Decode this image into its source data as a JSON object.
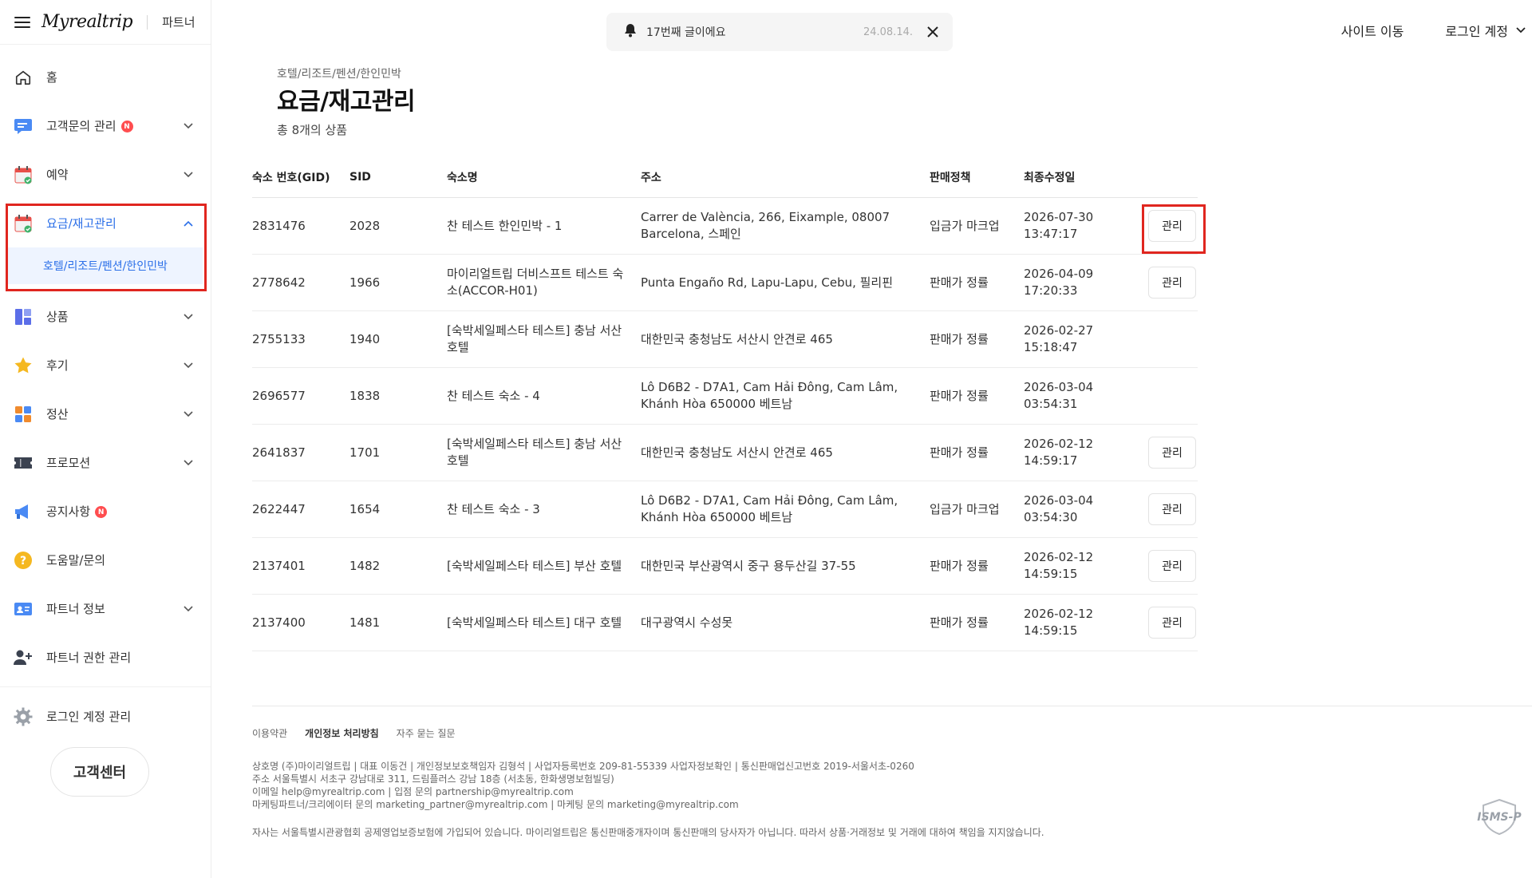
{
  "brand": {
    "logo": "Myrealtrip",
    "partner": "파트너"
  },
  "sidebar": {
    "items": [
      {
        "label": "홈",
        "icon": "home-icon",
        "badge": "",
        "chevron": ""
      },
      {
        "label": "고객문의 관리",
        "icon": "chat-icon",
        "badge": "N",
        "chevron": "down"
      },
      {
        "label": "예약",
        "icon": "calendar-check-icon",
        "badge": "",
        "chevron": "down"
      },
      {
        "label": "요금/재고관리",
        "icon": "calendar-check-icon",
        "badge": "",
        "chevron": "up"
      },
      {
        "label": "상품",
        "icon": "dashboard-icon",
        "badge": "",
        "chevron": "down"
      },
      {
        "label": "후기",
        "icon": "star-icon",
        "badge": "",
        "chevron": "down"
      },
      {
        "label": "정산",
        "icon": "grid-icon",
        "badge": "",
        "chevron": "down"
      },
      {
        "label": "프로모션",
        "icon": "ticket-icon",
        "badge": "",
        "chevron": "down"
      },
      {
        "label": "공지사항",
        "icon": "megaphone-icon",
        "badge": "N",
        "chevron": ""
      },
      {
        "label": "도움말/문의",
        "icon": "question-icon",
        "badge": "",
        "chevron": ""
      },
      {
        "label": "파트너 정보",
        "icon": "id-card-icon",
        "badge": "",
        "chevron": "down"
      },
      {
        "label": "파트너 권한 관리",
        "icon": "user-add-icon",
        "badge": "",
        "chevron": ""
      },
      {
        "label": "로그인 계정 관리",
        "icon": "gear-icon",
        "badge": "",
        "chevron": ""
      }
    ],
    "sub_item": "호텔/리조트/펜션/한인민박",
    "cs_button": "고객센터"
  },
  "notice": {
    "text": "17번째 글이에요",
    "date": "24.08.14."
  },
  "topbar": {
    "site_move": "사이트 이동",
    "account": "로그인 계정"
  },
  "main": {
    "breadcrumb": "호텔/리조트/펜션/한인민박",
    "title": "요금/재고관리",
    "count": "총 8개의 상품"
  },
  "table": {
    "headers": [
      "숙소 번호(GID)",
      "SID",
      "숙소명",
      "주소",
      "판매정책",
      "최종수정일"
    ],
    "rows": [
      {
        "gid": "2831476",
        "sid": "2028",
        "name": "찬 테스트 한인민박 - 1",
        "address": "Carrer de València, 266, Eixample, 08007 Barcelona, 스페인",
        "policy": "입금가 마크업",
        "date": "2026-07-30",
        "time": "13:47:17",
        "manage": "관리"
      },
      {
        "gid": "2778642",
        "sid": "1966",
        "name": "마이리얼트립 더비스프트 테스트 숙소(ACCOR-H01)",
        "address": "Punta Engaño Rd, Lapu-Lapu, Cebu, 필리핀",
        "policy": "판매가 정률",
        "date": "2026-04-09",
        "time": "17:20:33",
        "manage": "관리"
      },
      {
        "gid": "2755133",
        "sid": "1940",
        "name": "[숙박세일페스타 테스트] 충남 서산 호텔",
        "address": "대한민국 충청남도 서산시 안견로 465",
        "policy": "판매가 정률",
        "date": "2026-02-27",
        "time": "15:18:47",
        "manage": ""
      },
      {
        "gid": "2696577",
        "sid": "1838",
        "name": "찬 테스트 숙소 - 4",
        "address": "Lô D6B2 - D7A1, Cam Hải Đông, Cam Lâm, Khánh Hòa 650000 베트남",
        "policy": "판매가 정률",
        "date": "2026-03-04",
        "time": "03:54:31",
        "manage": ""
      },
      {
        "gid": "2641837",
        "sid": "1701",
        "name": "[숙박세일페스타 테스트] 충남 서산 호텔",
        "address": "대한민국 충청남도 서산시 안견로 465",
        "policy": "판매가 정률",
        "date": "2026-02-12",
        "time": "14:59:17",
        "manage": "관리"
      },
      {
        "gid": "2622447",
        "sid": "1654",
        "name": "찬 테스트 숙소 - 3",
        "address": "Lô D6B2 - D7A1, Cam Hải Đông, Cam Lâm, Khánh Hòa 650000 베트남",
        "policy": "입금가 마크업",
        "date": "2026-03-04",
        "time": "03:54:30",
        "manage": "관리"
      },
      {
        "gid": "2137401",
        "sid": "1482",
        "name": "[숙박세일페스타 테스트] 부산 호텔",
        "address": "대한민국 부산광역시 중구 용두산길 37-55",
        "policy": "판매가 정률",
        "date": "2026-02-12",
        "time": "14:59:15",
        "manage": "관리"
      },
      {
        "gid": "2137400",
        "sid": "1481",
        "name": "[숙박세일페스타 테스트] 대구 호텔",
        "address": "대구광역시 수성못",
        "policy": "판매가 정률",
        "date": "2026-02-12",
        "time": "14:59:15",
        "manage": "관리"
      }
    ]
  },
  "footer": {
    "links": [
      "이용약관",
      "개인정보 처리방침",
      "자주 묻는 질문"
    ],
    "info": [
      "상호명 (주)마이리얼트립 | 대표 이동건 | 개인정보보호책임자 김형석 | 사업자등록번호 209-81-55339 사업자정보확인 | 통신판매업신고번호 2019-서울서초-0260",
      "주소 서울특별시 서초구 강남대로 311, 드림플러스 강남 18층 (서초동, 한화생명보험빌딩)",
      "이메일 help@myrealtrip.com | 입점 문의 partnership@myrealtrip.com",
      "마케팅파트너/크리에이터 문의 marketing_partner@myrealtrip.com | 마케팅 문의 marketing@myrealtrip.com"
    ],
    "disclaimer": "자사는 서울특별시관광협회 공제영업보증보험에 가입되어 있습니다. 마이리얼트립은 통신판매중개자이며 통신판매의 당사자가 아닙니다. 따라서 상품·거래정보 및 거래에 대하여 책임을 지지않습니다.",
    "cert_logo": "ISMS-P"
  },
  "colors": {
    "accent": "#2b6fe8",
    "highlight": "#e0261f",
    "badge": "#ff4d4f"
  }
}
